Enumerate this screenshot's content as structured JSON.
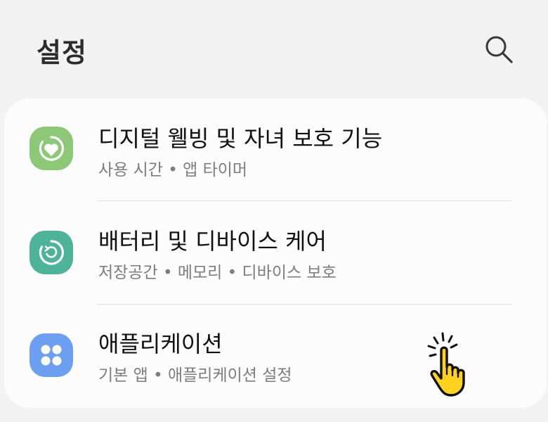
{
  "header": {
    "title": "설정",
    "search_icon": "search-icon"
  },
  "settings": {
    "items": [
      {
        "title": "디지털 웰빙 및 자녀 보호 기능",
        "subtitle": "사용 시간 • 앱 타이머",
        "icon": "digital-wellbeing-icon",
        "icon_color": "#8cc878"
      },
      {
        "title": "배터리 및 디바이스 케어",
        "subtitle": "저장공간 • 메모리 • 디바이스 보호",
        "icon": "device-care-icon",
        "icon_color": "#4fb39a"
      },
      {
        "title": "애플리케이션",
        "subtitle": "기본 앱 • 애플리케이션 설정",
        "icon": "apps-icon",
        "icon_color": "#6d9ff0"
      }
    ]
  },
  "overlay": {
    "icon": "tap-hand-icon",
    "color": "#ffd21f"
  },
  "colors": {
    "background": "#f2f2f2",
    "card": "#fcfcfc",
    "title_text": "#111111",
    "subtitle_text": "#7d7d7d"
  }
}
